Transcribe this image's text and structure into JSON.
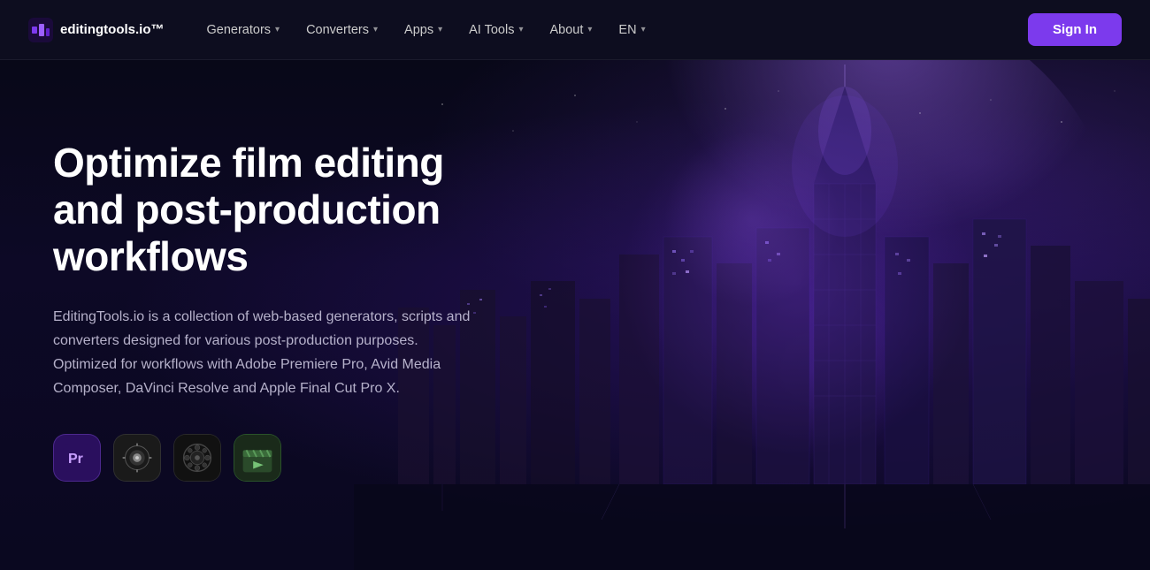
{
  "nav": {
    "logo_text": "editingtools.io™",
    "items": [
      {
        "label": "Generators",
        "has_dropdown": true
      },
      {
        "label": "Converters",
        "has_dropdown": true
      },
      {
        "label": "Apps",
        "has_dropdown": true
      },
      {
        "label": "AI Tools",
        "has_dropdown": true
      },
      {
        "label": "About",
        "has_dropdown": true
      },
      {
        "label": "EN",
        "has_dropdown": true
      }
    ],
    "sign_in": "Sign In"
  },
  "hero": {
    "title": "Optimize film editing and post-production workflows",
    "description": "EditingTools.io is a collection of web-based generators, scripts and converters designed for various post-production purposes. Optimized for workflows with Adobe Premiere Pro, Avid Media Composer, DaVinci Resolve and Apple Final Cut Pro X.",
    "apps": [
      {
        "id": "pr",
        "label": "Pr",
        "title": "Adobe Premiere Pro"
      },
      {
        "id": "davinci",
        "label": "DV",
        "title": "DaVinci Resolve"
      },
      {
        "id": "avid",
        "label": "AV",
        "title": "Avid Media Composer"
      },
      {
        "id": "fcp",
        "label": "FCP",
        "title": "Final Cut Pro X"
      }
    ]
  }
}
